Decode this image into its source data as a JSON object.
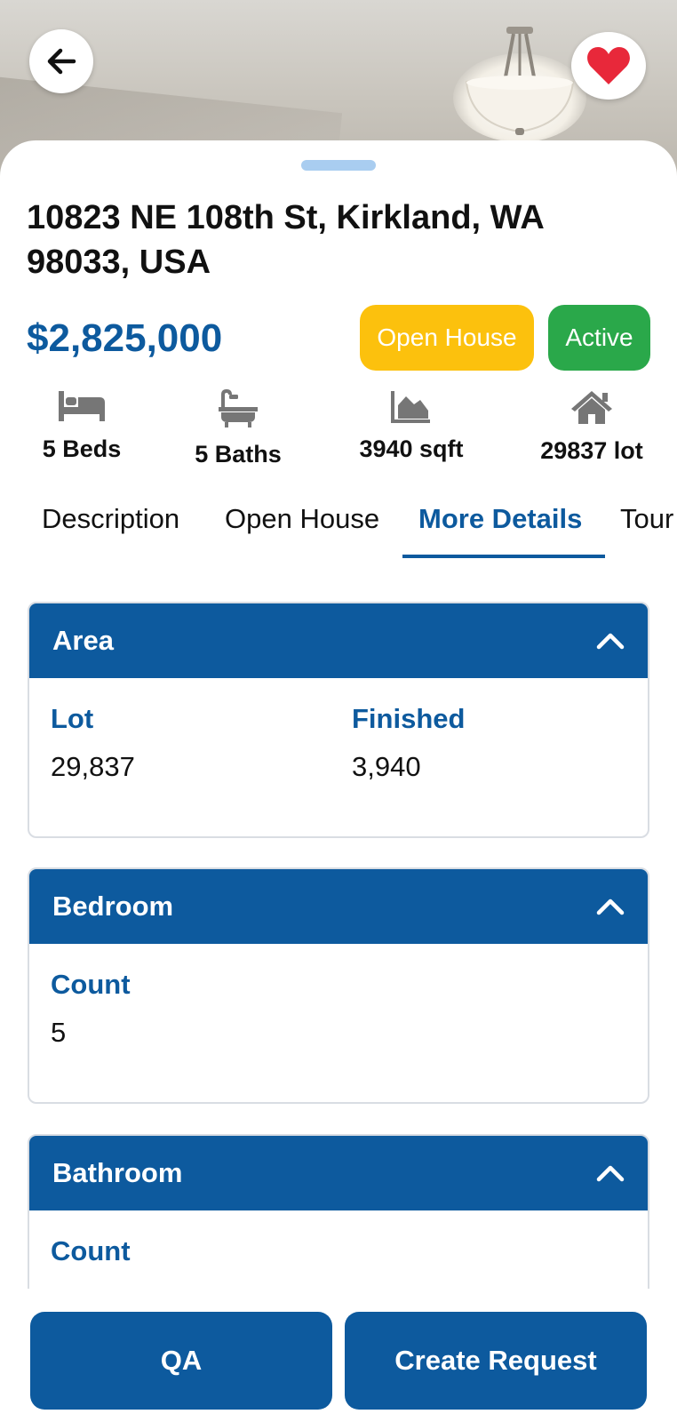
{
  "listing": {
    "address": "10823 NE 108th St, Kirkland, WA 98033, USA",
    "price": "$2,825,000",
    "badges": {
      "open_house": "Open House",
      "active": "Active"
    }
  },
  "stats": {
    "beds": "5 Beds",
    "baths": "5 Baths",
    "sqft": "3940 sqft",
    "lot": "29837 lot"
  },
  "tabs": [
    {
      "label": "Description"
    },
    {
      "label": "Open House"
    },
    {
      "label": "More Details"
    },
    {
      "label": "Tour"
    }
  ],
  "active_tab": "More Details",
  "sections": {
    "area": {
      "title": "Area",
      "lot_label": "Lot",
      "lot_value": "29,837",
      "finished_label": "Finished",
      "finished_value": "3,940"
    },
    "bedroom": {
      "title": "Bedroom",
      "count_label": "Count",
      "count_value": "5"
    },
    "bathroom": {
      "title": "Bathroom",
      "count_label": "Count"
    }
  },
  "actions": {
    "qa": "QA",
    "create_request": "Create Request"
  },
  "colors": {
    "primary": "#0d5a9e",
    "open_house_badge": "#fcc10d",
    "active_badge": "#2aa84a",
    "favorite": "#e8283a",
    "handle": "#a9cdf0"
  },
  "icons": [
    "arrow-left-icon",
    "heart-icon",
    "bed-icon",
    "bathtub-icon",
    "area-chart-icon",
    "house-icon",
    "chevron-up-icon"
  ]
}
